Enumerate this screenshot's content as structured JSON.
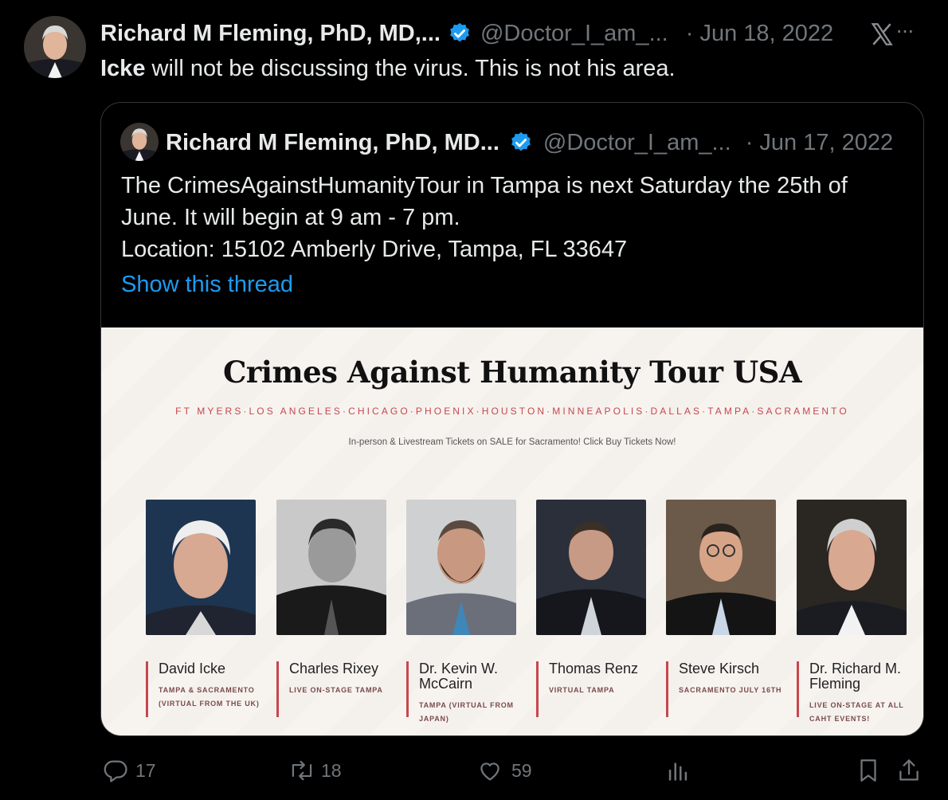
{
  "tweet": {
    "author_name": "Richard M Fleming, PhD, MD,...",
    "handle": "@Doctor_I_am_...",
    "date": "· Jun 18, 2022",
    "text_bold": "Icke",
    "text_rest": " will not be discussing the virus. This is not his area.",
    "more_label": "···"
  },
  "quoted": {
    "author_name": "Richard M Fleming, PhD, MD...",
    "handle": "@Doctor_I_am_...",
    "date": "· Jun 17, 2022",
    "text_line1": "The CrimesAgainstHumanityTour in Tampa is next Saturday the 25th of June. It will begin at 9 am - 7 pm.",
    "text_line2": "Location: 15102 Amberly Drive, Tampa, FL 33647",
    "show_thread": "Show this thread"
  },
  "media": {
    "title": "Crimes Against Humanity Tour USA",
    "cities": "FT MYERS·LOS ANGELES·CHICAGO·PHOENIX·HOUSTON·MINNEAPOLIS·DALLAS·TAMPA·SACRAMENTO",
    "subtitle": "In-person & Livestream Tickets on SALE for Sacramento! Click Buy Tickets Now!",
    "speakers": [
      {
        "name": "David Icke",
        "role": "TAMPA & SACRAMENTO (VIRTUAL FROM THE UK)"
      },
      {
        "name": "Charles Rixey",
        "role": "LIVE ON-STAGE TAMPA"
      },
      {
        "name": "Dr. Kevin W. McCairn",
        "role": "TAMPA (VIRTUAL FROM JAPAN)"
      },
      {
        "name": "Thomas Renz",
        "role": "VIRTUAL TAMPA"
      },
      {
        "name": "Steve Kirsch",
        "role": "SACRAMENTO JULY 16TH"
      },
      {
        "name": "Dr. Richard M. Fleming",
        "role": "LIVE ON-STAGE AT ALL CAHT EVENTS!"
      }
    ]
  },
  "actions": {
    "replies": "17",
    "retweets": "18",
    "likes": "59"
  },
  "colors": {
    "verified": "#1d9bf0",
    "link": "#1d9bf0",
    "accent_red": "#c8464c"
  },
  "icons": [
    "verified-badge-icon",
    "x-logo-icon",
    "more-icon",
    "reply-icon",
    "retweet-icon",
    "like-icon",
    "analytics-icon",
    "bookmark-icon",
    "share-icon"
  ]
}
